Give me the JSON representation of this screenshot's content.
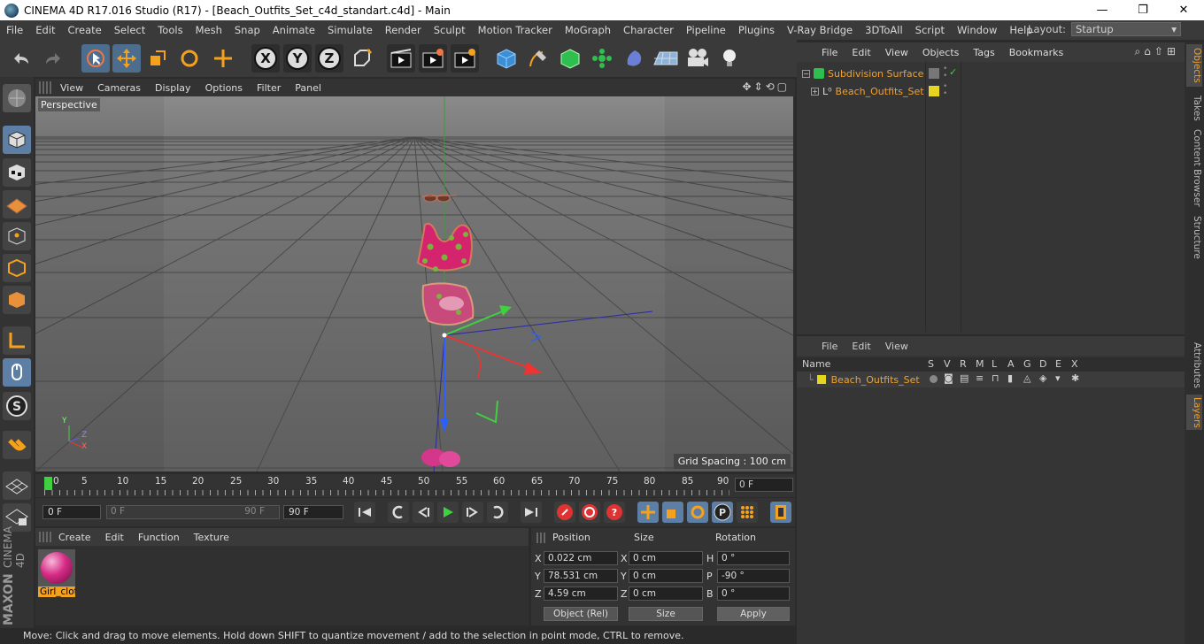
{
  "window": {
    "title": "CINEMA 4D R17.016 Studio (R17) - [Beach_Outfits_Set_c4d_standart.c4d] - Main",
    "minimize": "—",
    "maximize": "❐",
    "close": "✕"
  },
  "menubar": {
    "items": [
      "File",
      "Edit",
      "Create",
      "Select",
      "Tools",
      "Mesh",
      "Snap",
      "Animate",
      "Simulate",
      "Render",
      "Sculpt",
      "Motion Tracker",
      "MoGraph",
      "Character",
      "Pipeline",
      "Plugins",
      "V-Ray Bridge",
      "3DToAll",
      "Script",
      "Window",
      "Help"
    ],
    "layout_label": "Layout:",
    "layout_value": "Startup"
  },
  "toolbar": {
    "axis_x": "X",
    "axis_y": "Y",
    "axis_z": "Z"
  },
  "viewport": {
    "menu": [
      "View",
      "Cameras",
      "Display",
      "Options",
      "Filter",
      "Panel"
    ],
    "label": "Perspective",
    "grid_spacing": "Grid Spacing : 100 cm",
    "axis_y": "Y",
    "axis_z": "Z",
    "axis_x": "X"
  },
  "timeline": {
    "ticks": [
      "0",
      "5",
      "10",
      "15",
      "20",
      "25",
      "30",
      "35",
      "40",
      "45",
      "50",
      "55",
      "60",
      "65",
      "70",
      "75",
      "80",
      "85",
      "90"
    ],
    "end_frame": "0 F"
  },
  "transport": {
    "current_frame": "0 F",
    "range_start": "0 F",
    "range_end_inner": "90 F",
    "range_end": "90 F"
  },
  "material_manager": {
    "menu": [
      "Create",
      "Edit",
      "Function",
      "Texture"
    ],
    "material_name": "Girl_clot"
  },
  "coordinates": {
    "headers": {
      "position": "Position",
      "size": "Size",
      "rotation": "Rotation"
    },
    "rows": [
      {
        "axis": "X",
        "pos": "0.022 cm",
        "size_axis": "X",
        "size": "0 cm",
        "rot_axis": "H",
        "rot": "0 °"
      },
      {
        "axis": "Y",
        "pos": "78.531 cm",
        "size_axis": "Y",
        "size": "0 cm",
        "rot_axis": "P",
        "rot": "-90 °"
      },
      {
        "axis": "Z",
        "pos": "4.59 cm",
        "size_axis": "Z",
        "size": "0 cm",
        "rot_axis": "B",
        "rot": "0 °"
      }
    ],
    "mode": "Object (Rel)",
    "size_mode": "Size",
    "apply": "Apply"
  },
  "status": {
    "text": "Move: Click and drag to move elements. Hold down SHIFT to quantize movement / add to the selection in point mode, CTRL to remove."
  },
  "object_manager": {
    "menu": [
      "File",
      "Edit",
      "View",
      "Objects",
      "Tags",
      "Bookmarks"
    ],
    "objects": [
      "Subdivision Surface",
      "Beach_Outfits_Set"
    ]
  },
  "layer_manager": {
    "menu": [
      "File",
      "Edit",
      "View"
    ],
    "col_name": "Name",
    "cols": [
      "S",
      "V",
      "R",
      "M",
      "L",
      "A",
      "G",
      "D",
      "E",
      "X"
    ],
    "layers": [
      "Beach_Outfits_Set"
    ]
  },
  "right_tabs": [
    "Objects",
    "Takes",
    "Content Browser",
    "Structure",
    "Attributes",
    "Layers"
  ],
  "brand": {
    "maxon": "MAXON",
    "product": "CINEMA 4D"
  },
  "colors": {
    "accent_orange": "#f0a030",
    "layer_yellow": "#e5d520",
    "highlight_blue": "#5d7fa6"
  }
}
